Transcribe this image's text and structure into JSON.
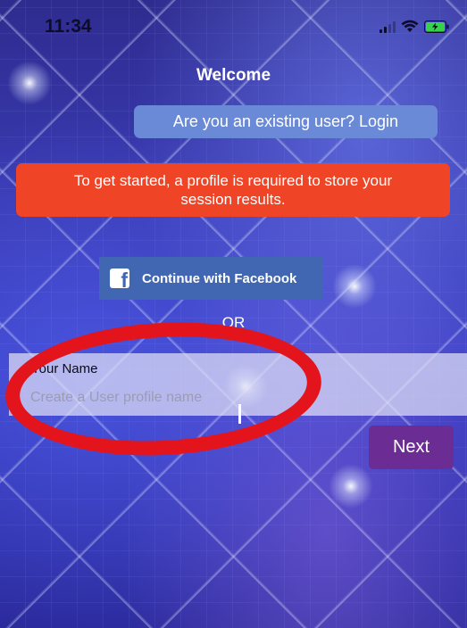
{
  "status_bar": {
    "time": "11:34",
    "signal_icon": "cellular-signal-icon",
    "wifi_icon": "wifi-icon",
    "battery_icon": "battery-charging-icon"
  },
  "header": {
    "title": "Welcome"
  },
  "login": {
    "label": "Are you an existing user? Login"
  },
  "notice": {
    "text": "To get started, a profile is required to store your session results."
  },
  "facebook": {
    "icon": "facebook-icon",
    "icon_glyph": "f",
    "label": "Continue with Facebook"
  },
  "divider": {
    "text": "OR"
  },
  "profile_form": {
    "name_label": "Your Name",
    "name_placeholder": "Create a User profile name",
    "name_value": ""
  },
  "actions": {
    "next_label": "Next"
  },
  "colors": {
    "login_button": "#6a8ad8",
    "notice_banner": "#ef4426",
    "facebook_button": "#4267b2",
    "next_button": "#6b2c93",
    "annotation_circle": "#e3141b"
  }
}
